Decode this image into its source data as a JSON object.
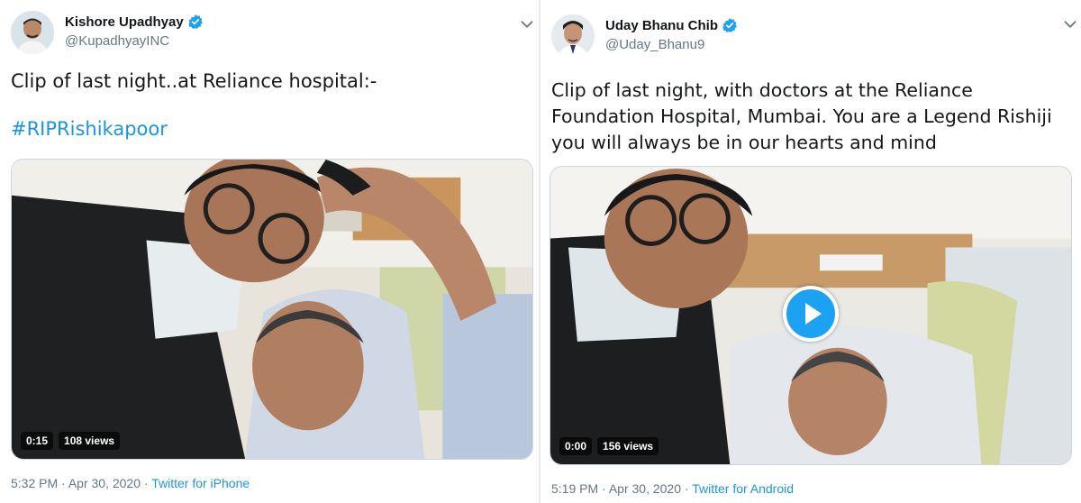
{
  "tweets": [
    {
      "display_name": "Kishore Upadhyay",
      "handle": "@KupadhyayINC",
      "text": "Clip of last night..at Reliance hospital:-",
      "hashtag": "#RIPRishikapoor",
      "video": {
        "time": "0:15",
        "views": "108 views"
      },
      "time": "5:32 PM",
      "date": "Apr 30, 2020",
      "separator": "·",
      "source": "Twitter for iPhone"
    },
    {
      "display_name": "Uday Bhanu Chib",
      "handle": "@Uday_Bhanu9",
      "text_lines": [
        "Clip of last night, with doctors at the Reliance",
        "Foundation Hospital, Mumbai. You are a Legend Rishiji",
        "you will always be in our hearts and mind"
      ],
      "video": {
        "time": "0:00",
        "views": "156 views"
      },
      "time": "5:19 PM",
      "date": "Apr 30, 2020",
      "separator": "·",
      "source": "Twitter for Android"
    }
  ],
  "icons": {
    "verified": "verified-badge-icon",
    "more": "chevron-down-icon",
    "play": "play-icon"
  },
  "colors": {
    "accent": "#1da1f2",
    "link": "#1b95e0",
    "text": "#14171a",
    "muted": "#657786",
    "border": "#e6ecf0"
  }
}
